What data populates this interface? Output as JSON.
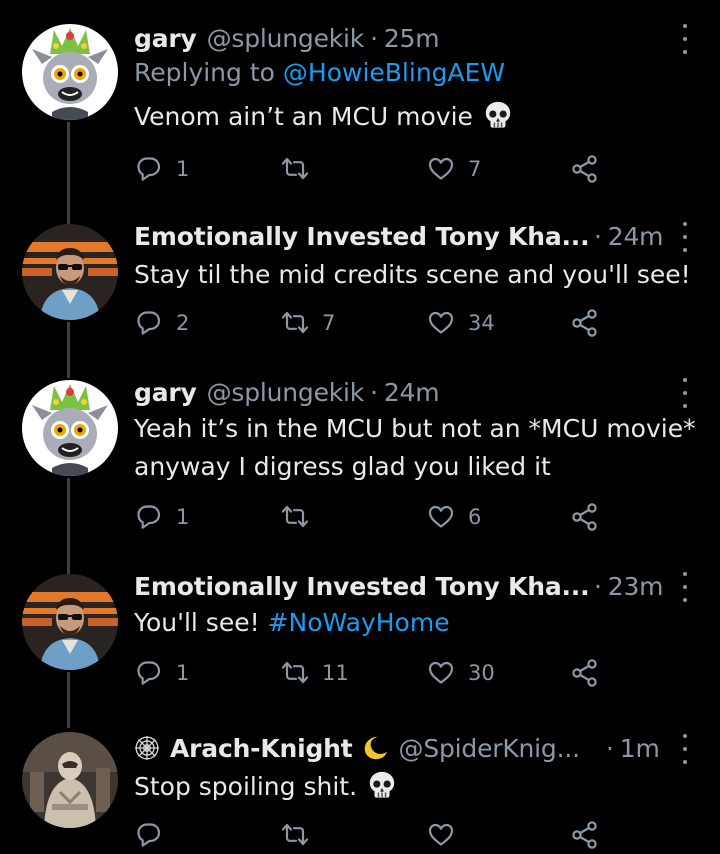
{
  "tweets": [
    {
      "author": "gary",
      "handle": "@splungekik",
      "separator": "·",
      "time": "25m",
      "replying_prefix": "Replying to",
      "replying_to": "@HowieBlingAEW",
      "text_lines": [
        "Venom ain’t an MCU movie"
      ],
      "emoji": "skull-icon",
      "reply_count": "1",
      "retweet_count": "",
      "like_count": "7"
    },
    {
      "author": "Emotionally Invested Tony Kha...",
      "separator": "·",
      "time": "24m",
      "text_lines": [
        "Stay til the mid credits scene and you'll see!"
      ],
      "reply_count": "2",
      "retweet_count": "7",
      "like_count": "34"
    },
    {
      "author": "gary",
      "handle": "@splungekik",
      "separator": "·",
      "time": "24m",
      "text_lines": [
        "Yeah it’s in the MCU but not an *MCU movie*",
        "anyway I digress glad you liked it"
      ],
      "reply_count": "1",
      "retweet_count": "",
      "like_count": "6"
    },
    {
      "author": "Emotionally Invested Tony Kha...",
      "separator": "·",
      "time": "23m",
      "text_prefix": "You'll see! ",
      "hashtag": "#NoWayHome",
      "reply_count": "1",
      "retweet_count": "11",
      "like_count": "30"
    },
    {
      "author": "Arach-Knight",
      "name_prefix_icon": "spiderweb-icon",
      "name_suffix_icon": "crescent-moon-icon",
      "handle": "@SpiderKnig...",
      "separator": "·",
      "time": "1m",
      "text_lines": [
        "Stop spoiling shit."
      ],
      "emoji": "skull-icon",
      "reply_count": "",
      "retweet_count": "",
      "like_count": ""
    }
  ],
  "colors": {
    "background": "#000000",
    "text": "#e7e9ea",
    "secondary": "#8b98a5",
    "link": "#1d9bf0",
    "thread_line": "#3b3e42"
  }
}
